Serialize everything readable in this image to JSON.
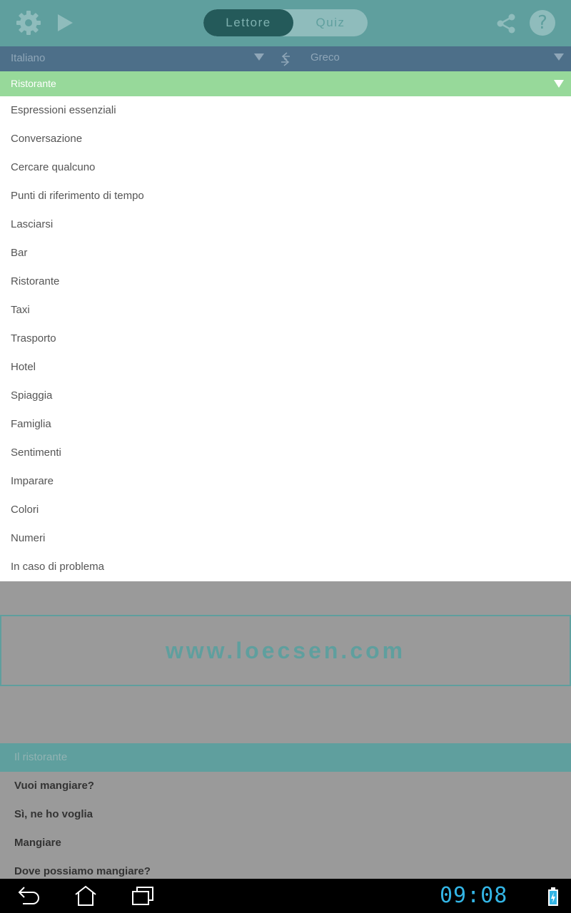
{
  "toolbar": {
    "tabs": {
      "reader": "Lettore",
      "quiz": "Quiz",
      "active": "Lettore"
    },
    "icons": [
      "gear-icon",
      "play-icon",
      "share-icon",
      "help-icon"
    ],
    "help_glyph": "?"
  },
  "languages": {
    "source": "Italiano",
    "target": "Greco"
  },
  "dropdown": {
    "selected": "Ristorante",
    "items": [
      "Espressioni essenziali",
      "Conversazione",
      "Cercare qualcuno",
      "Punti di riferimento di tempo",
      "Lasciarsi",
      "Bar",
      "Ristorante",
      "Taxi",
      "Trasporto",
      "Hotel",
      "Spiaggia",
      "Famiglia",
      "Sentimenti",
      "Imparare",
      "Colori",
      "Numeri",
      "In caso di problema"
    ]
  },
  "banner": {
    "url": "www.loecsen.com"
  },
  "section": {
    "title": "Il ristorante",
    "phrases": [
      "Vuoi mangiare?",
      "Sì, ne ho voglia",
      "Mangiare",
      "Dove possiamo mangiare?"
    ]
  },
  "statusbar": {
    "time": "09:08"
  },
  "colors": {
    "toolbar": "#5f9f9e",
    "language_bar": "#4d6f89",
    "dropdown_header": "#97d99a",
    "active_tab": "#245a5a",
    "clock": "#33b5e5"
  }
}
